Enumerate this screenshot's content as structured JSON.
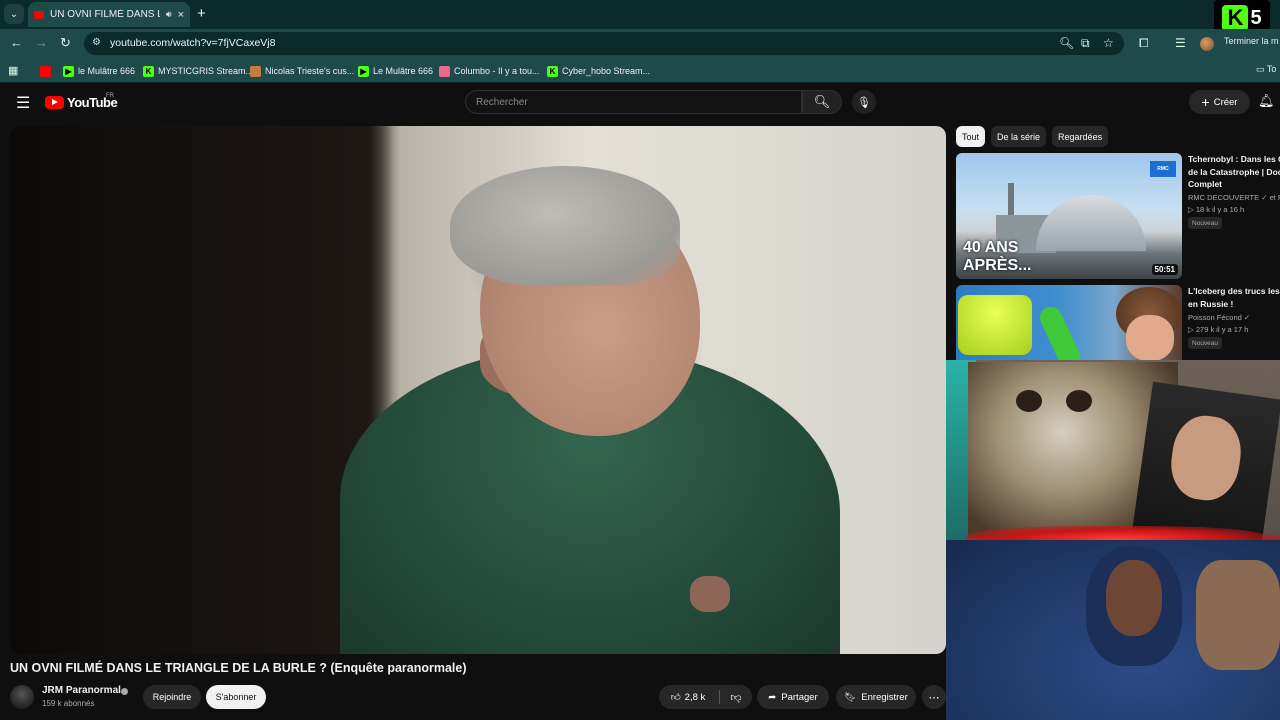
{
  "browser": {
    "tab": {
      "title": "UN OVNI FILMÉ DANS LE TRIANGLE",
      "audio_icon": "speaker-icon",
      "close_label": "×"
    },
    "new_tab_label": "+",
    "url": "youtube.com/watch?v=7fjVCaxeVj8",
    "finish_label": "Terminer la m",
    "kick_badge": {
      "letter": "K",
      "number": "5"
    },
    "bookmarks": [
      {
        "label": "",
        "icon": "youtube-icon"
      },
      {
        "label": "le Mulâtre 666",
        "icon": "kick-play-icon"
      },
      {
        "label": "MYSTICGRIS Stream...",
        "icon": "kick-icon"
      },
      {
        "label": "Nicolas Trieste's cus...",
        "icon": "fox-icon"
      },
      {
        "label": "Le Mulâtre 666",
        "icon": "kick-play-icon"
      },
      {
        "label": "Columbo - Il y a tou...",
        "icon": "columbo-icon"
      },
      {
        "label": "Cyber_hobo Stream...",
        "icon": "kick-icon"
      }
    ],
    "bookmarks_folder": "To"
  },
  "youtube": {
    "logo_text": "YouTube",
    "country": "FR",
    "search_placeholder": "Rechercher",
    "create_label": "Créer"
  },
  "video": {
    "title": "UN OVNI FILMÉ DANS LE TRIANGLE DE LA BURLE ? (Enquête paranormale)",
    "channel": "JRM Paranormal",
    "subscribers": "159 k abonnés",
    "join_label": "Rejoindre",
    "subscribe_label": "S'abonner",
    "likes": "2,8 k",
    "share_label": "Partager",
    "save_label": "Enregistrer",
    "more_label": "⋯"
  },
  "sidebar": {
    "chips": [
      "Tout",
      "De la série",
      "Regardées"
    ],
    "recommendations": [
      {
        "title_lines": [
          "Tchernobyl : Dans les C",
          "de la Catastrophe | Doc",
          "Complet"
        ],
        "channel": "RMC DECOUVERTE ✓ et RI",
        "meta": "▷ 18 k  il y a 16 h",
        "badge": "Nouveau",
        "overlay_text_1": "40 ANS",
        "overlay_text_2": "APRÈS...",
        "thumb_badge": "RMC",
        "duration": "50:51"
      },
      {
        "title_lines": [
          "L'Iceberg des trucs les p",
          "en Russie !"
        ],
        "channel": "Poisson Fécond ✓",
        "meta": "▷ 279 k  il y a 17 h",
        "badge": "Nouveau"
      }
    ]
  },
  "colors": {
    "browser_chrome": "#1f4a4a",
    "youtube_red": "#ff0000",
    "kick_green": "#53fc18",
    "page_background": "#0f0f0f"
  }
}
